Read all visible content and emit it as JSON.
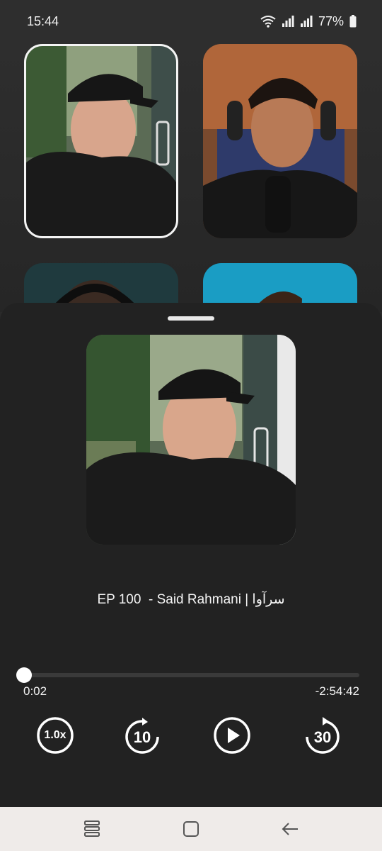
{
  "status_bar": {
    "time": "15:44",
    "battery": "77%",
    "icons": [
      "wifi-icon",
      "signal-icon",
      "signal-icon",
      "battery-icon"
    ]
  },
  "episode": {
    "title": "EP 100  - Said Rahmani | سرآوا"
  },
  "player": {
    "elapsed": "0:02",
    "remaining": "-2:54:42",
    "progress": 0.0002,
    "speed_label": "1.0x",
    "rewind_label": "10",
    "forward_label": "30"
  },
  "navigation": {
    "icons": [
      "recent-apps-icon",
      "home-icon",
      "back-icon"
    ]
  },
  "colors": {
    "background": "#2a2a2a",
    "sheet": "#222222",
    "accent": "#ffffff",
    "track": "#3a3a3a",
    "nav": "#efebe9"
  }
}
